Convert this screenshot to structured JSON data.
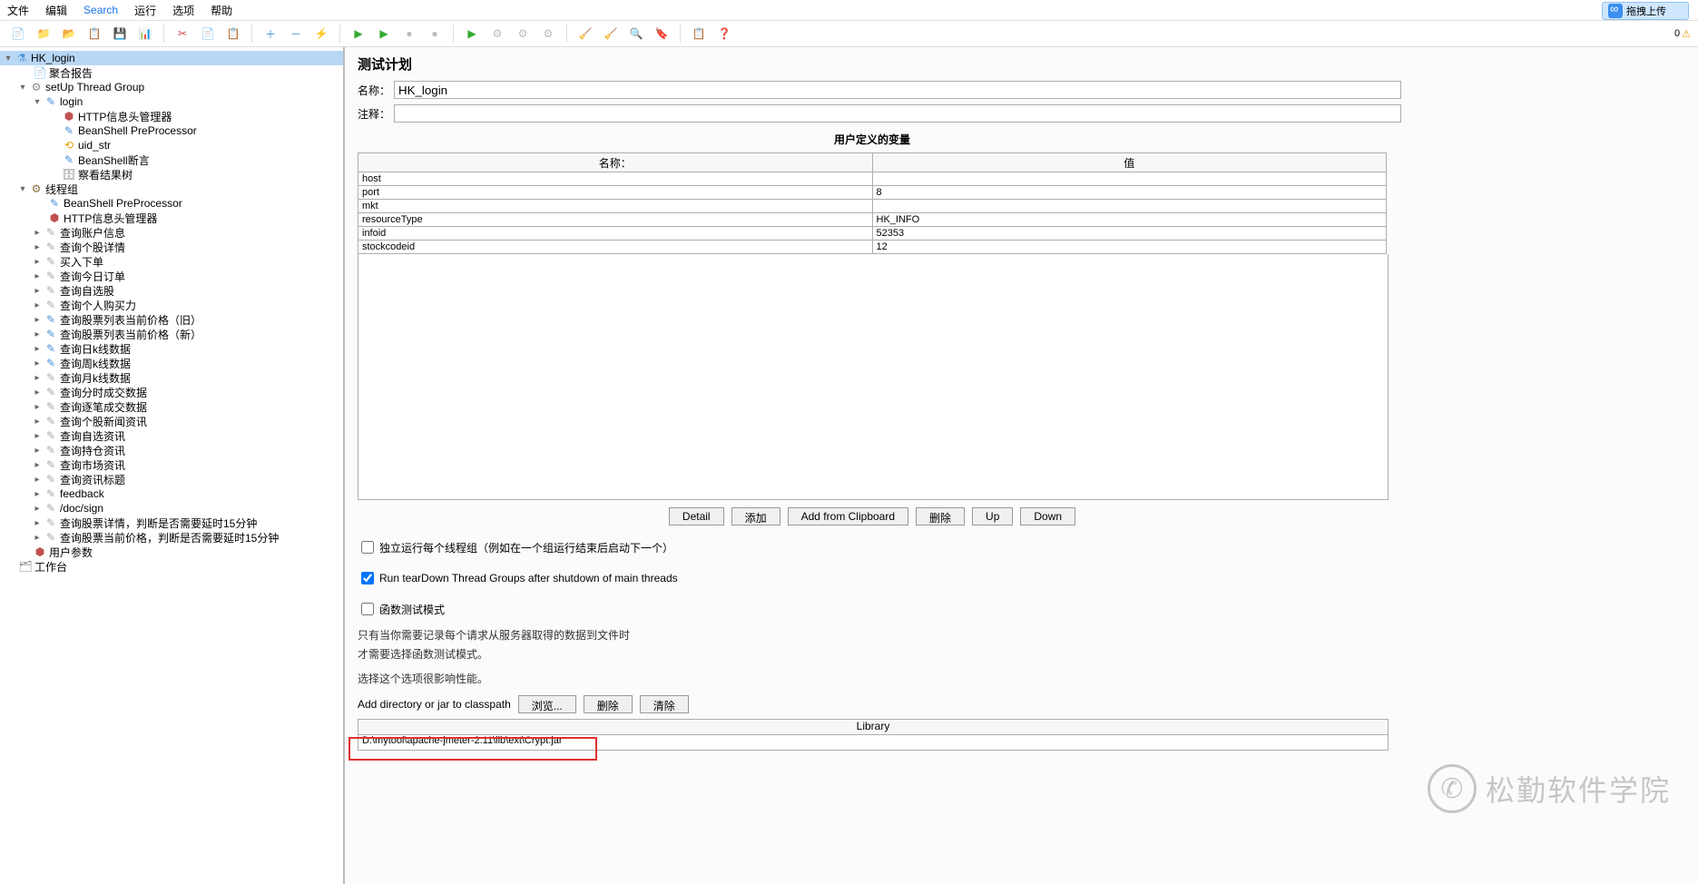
{
  "menu": {
    "file": "文件",
    "edit": "编辑",
    "search": "Search",
    "run": "运行",
    "options": "选项",
    "help": "帮助",
    "upload": "拖拽上传"
  },
  "toolbar_right": {
    "count": "0"
  },
  "tree": {
    "root": "HK_login",
    "n1": "聚合报告",
    "n2": "setUp Thread Group",
    "n3": "login",
    "n4": "HTTP信息头管理器",
    "n5": "BeanShell PreProcessor",
    "n6": "uid_str",
    "n7": "BeanShell断言",
    "n8": "察看结果树",
    "n9": "线程组",
    "n10": "BeanShell PreProcessor",
    "n11": "HTTP信息头管理器",
    "n12": "查询账户信息",
    "n13": "查询个股详情",
    "n14": "买入下单",
    "n15": "查询今日订单",
    "n16": "查询自选股",
    "n17": "查询个人购买力",
    "n18": "查询股票列表当前价格（旧）",
    "n19": "查询股票列表当前价格（新）",
    "n20": "查询日k线数据",
    "n21": "查询周k线数据",
    "n22": "查询月k线数据",
    "n23": "查询分时成交数据",
    "n24": "查询逐笔成交数据",
    "n25": "查询个股新闻资讯",
    "n26": "查询自选资讯",
    "n27": "查询持仓资讯",
    "n28": "查询市场资讯",
    "n29": "查询资讯标题",
    "n30": "feedback",
    "n31": "/doc/sign",
    "n32": "查询股票详情，判断是否需要延时15分钟",
    "n33": "查询股票当前价格，判断是否需要延时15分钟",
    "n34": "用户参数",
    "n35": "工作台"
  },
  "panel": {
    "title": "测试计划",
    "name_label": "名称：",
    "name_value": "HK_login",
    "comment_label": "注释：",
    "comment_value": "",
    "vars_title": "用户定义的变量",
    "col_name": "名称：",
    "col_value": "值",
    "rows": [
      {
        "k": "host",
        "v": ""
      },
      {
        "k": "port",
        "v": "8"
      },
      {
        "k": "mkt",
        "v": ""
      },
      {
        "k": "resourceType",
        "v": "HK_INFO"
      },
      {
        "k": "infoid",
        "v": "52353"
      },
      {
        "k": "stockcodeid",
        "v": "12"
      }
    ],
    "btn_detail": "Detail",
    "btn_add": "添加",
    "btn_clip": "Add from Clipboard",
    "btn_del": "删除",
    "btn_up": "Up",
    "btn_down": "Down",
    "chk1": "独立运行每个线程组（例如在一个组运行结束后启动下一个）",
    "chk2": "Run tearDown Thread Groups after shutdown of main threads",
    "chk3": "函数测试模式",
    "note1": "只有当你需要记录每个请求从服务器取得的数据到文件时",
    "note2": "才需要选择函数测试模式。",
    "note3": "选择这个选项很影响性能。",
    "classpath_label": "Add directory or jar to classpath",
    "btn_browse": "浏览...",
    "btn_del2": "删除",
    "btn_clear": "清除",
    "lib_header": "Library",
    "lib_value": "D:\\mytool\\apache-jmeter-2.11\\lib\\ext\\Crypt.jar"
  },
  "watermark": "松勤软件学院"
}
